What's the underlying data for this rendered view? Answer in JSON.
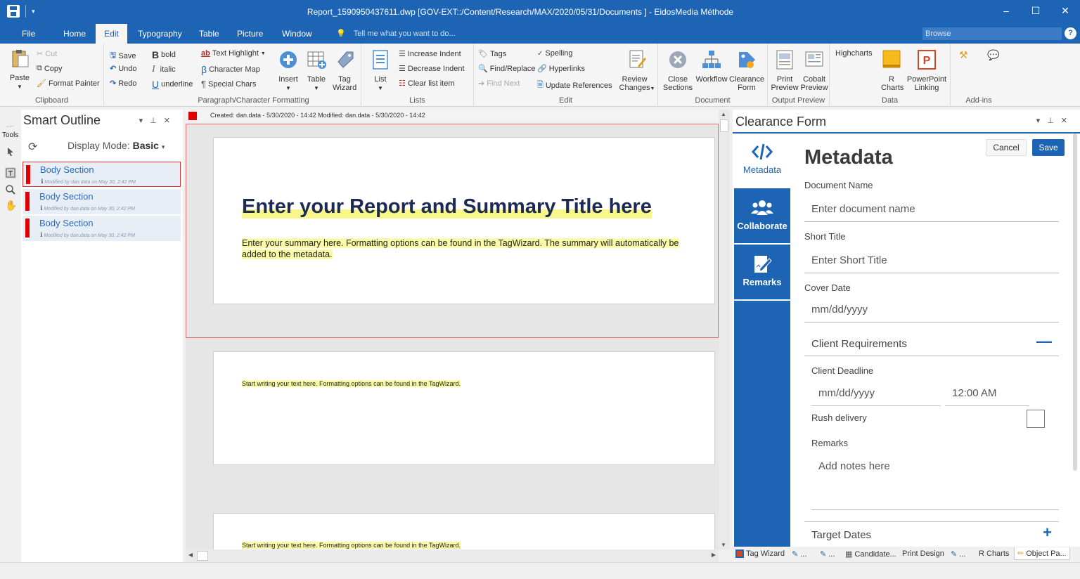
{
  "window": {
    "title": "Report_1590950437611.dwp  [GOV-EXT::/Content/Research/MAX/2020/05/31/Documents ] - EidosMedia Méthode",
    "minimize": "–",
    "maximize": "☐",
    "close": "✕"
  },
  "menu": {
    "tabs": [
      "File",
      "Home",
      "Edit",
      "Typography",
      "Table",
      "Picture",
      "Window"
    ],
    "active": "Edit",
    "tellme": "Tell me what you want to do...",
    "browse_placeholder": "Browse",
    "help": "?"
  },
  "ribbon": {
    "clipboard": {
      "label": "Clipboard",
      "paste": "Paste",
      "cut": "Cut",
      "copy": "Copy",
      "format_painter": "Format Painter"
    },
    "history": {
      "save": "Save",
      "undo": "Undo",
      "redo": "Redo"
    },
    "formatting": {
      "label": "Paragraph/Character Formatting",
      "bold": "bold",
      "italic": "italic",
      "underline": "underline",
      "text_highlight": "Text Highlight",
      "character_map": "Character Map",
      "special_chars": "Special Chars",
      "insert": "Insert",
      "table": "Table",
      "tag_wizard": "Tag Wizard"
    },
    "lists": {
      "label": "Lists",
      "list": "List",
      "increase_indent": "Increase Indent",
      "decrease_indent": "Decrease Indent",
      "clear_list_item": "Clear list item"
    },
    "edit": {
      "label": "Edit",
      "tags": "Tags",
      "find_replace": "Find/Replace",
      "find_next": "Find Next",
      "spelling": "Spelling",
      "hyperlinks": "Hyperlinks",
      "update_references": "Update References",
      "review_changes": "Review Changes"
    },
    "document": {
      "label": "Document",
      "close_sections": "Close Sections",
      "workflow": "Workflow",
      "clearance_form": "Clearance Form"
    },
    "output_preview": {
      "label": "Output Preview",
      "print_preview": "Print Preview",
      "cobalt_preview": "Cobalt Preview"
    },
    "data": {
      "label": "Data",
      "highcharts": "Highcharts",
      "r_charts": "R Charts",
      "powerpoint_linking": "PowerPoint Linking"
    },
    "addins": {
      "label": "Add-ins"
    }
  },
  "tools": {
    "label": "Tools"
  },
  "outline": {
    "title": "Smart Outline",
    "display_mode_label": "Display Mode:",
    "display_mode_value": "Basic",
    "items": [
      {
        "name": "Body Section",
        "meta": "Modified by dan.data on May 30, 2:42 PM"
      },
      {
        "name": "Body Section",
        "meta": "Modified by dan.data on May 30, 2:42 PM"
      },
      {
        "name": "Body Section",
        "meta": "Modified by dan.data on May 30, 2:42 PM"
      }
    ]
  },
  "document": {
    "info": "Created: dan.data - 5/30/2020 - 14:42   Modified: dan.data - 5/30/2020 - 14:42",
    "title_placeholder": "Enter your Report and Summary Title here",
    "summary_placeholder": "Enter your summary here. Formatting options can be found in the TagWizard. The summary will automatically be added to the metadata.",
    "body_placeholder_1": "Start writing your text here. Formatting options can be found in the TagWizard.",
    "body_placeholder_2": "Start writing your text here. Formatting options can be found in the TagWizard."
  },
  "clearance": {
    "title": "Clearance Form",
    "tabs": [
      "Metadata",
      "Collaborate",
      "Remarks"
    ],
    "active_tab": "Metadata",
    "heading": "Metadata",
    "cancel": "Cancel",
    "save": "Save",
    "document_name_label": "Document Name",
    "document_name_placeholder": "Enter document name",
    "short_title_label": "Short Title",
    "short_title_placeholder": "Enter Short Title",
    "cover_date_label": "Cover Date",
    "cover_date_placeholder": "mm/dd/yyyy",
    "client_requirements": "Client Requirements",
    "client_deadline_label": "Client Deadline",
    "client_deadline_date": "mm/dd/yyyy",
    "client_deadline_time": "12:00 AM",
    "rush_delivery": "Rush delivery",
    "remarks_label": "Remarks",
    "remarks_placeholder": "Add notes here",
    "target_dates": "Target Dates",
    "collapse": "—",
    "expand": "+"
  },
  "bottom_tabs": [
    {
      "label": "Tag Wizard"
    },
    {
      "label": "..."
    },
    {
      "label": "..."
    },
    {
      "label": "Candidate..."
    },
    {
      "label": "Print Design"
    },
    {
      "label": "..."
    },
    {
      "label": "R Charts"
    },
    {
      "label": "Object Pa..."
    }
  ]
}
